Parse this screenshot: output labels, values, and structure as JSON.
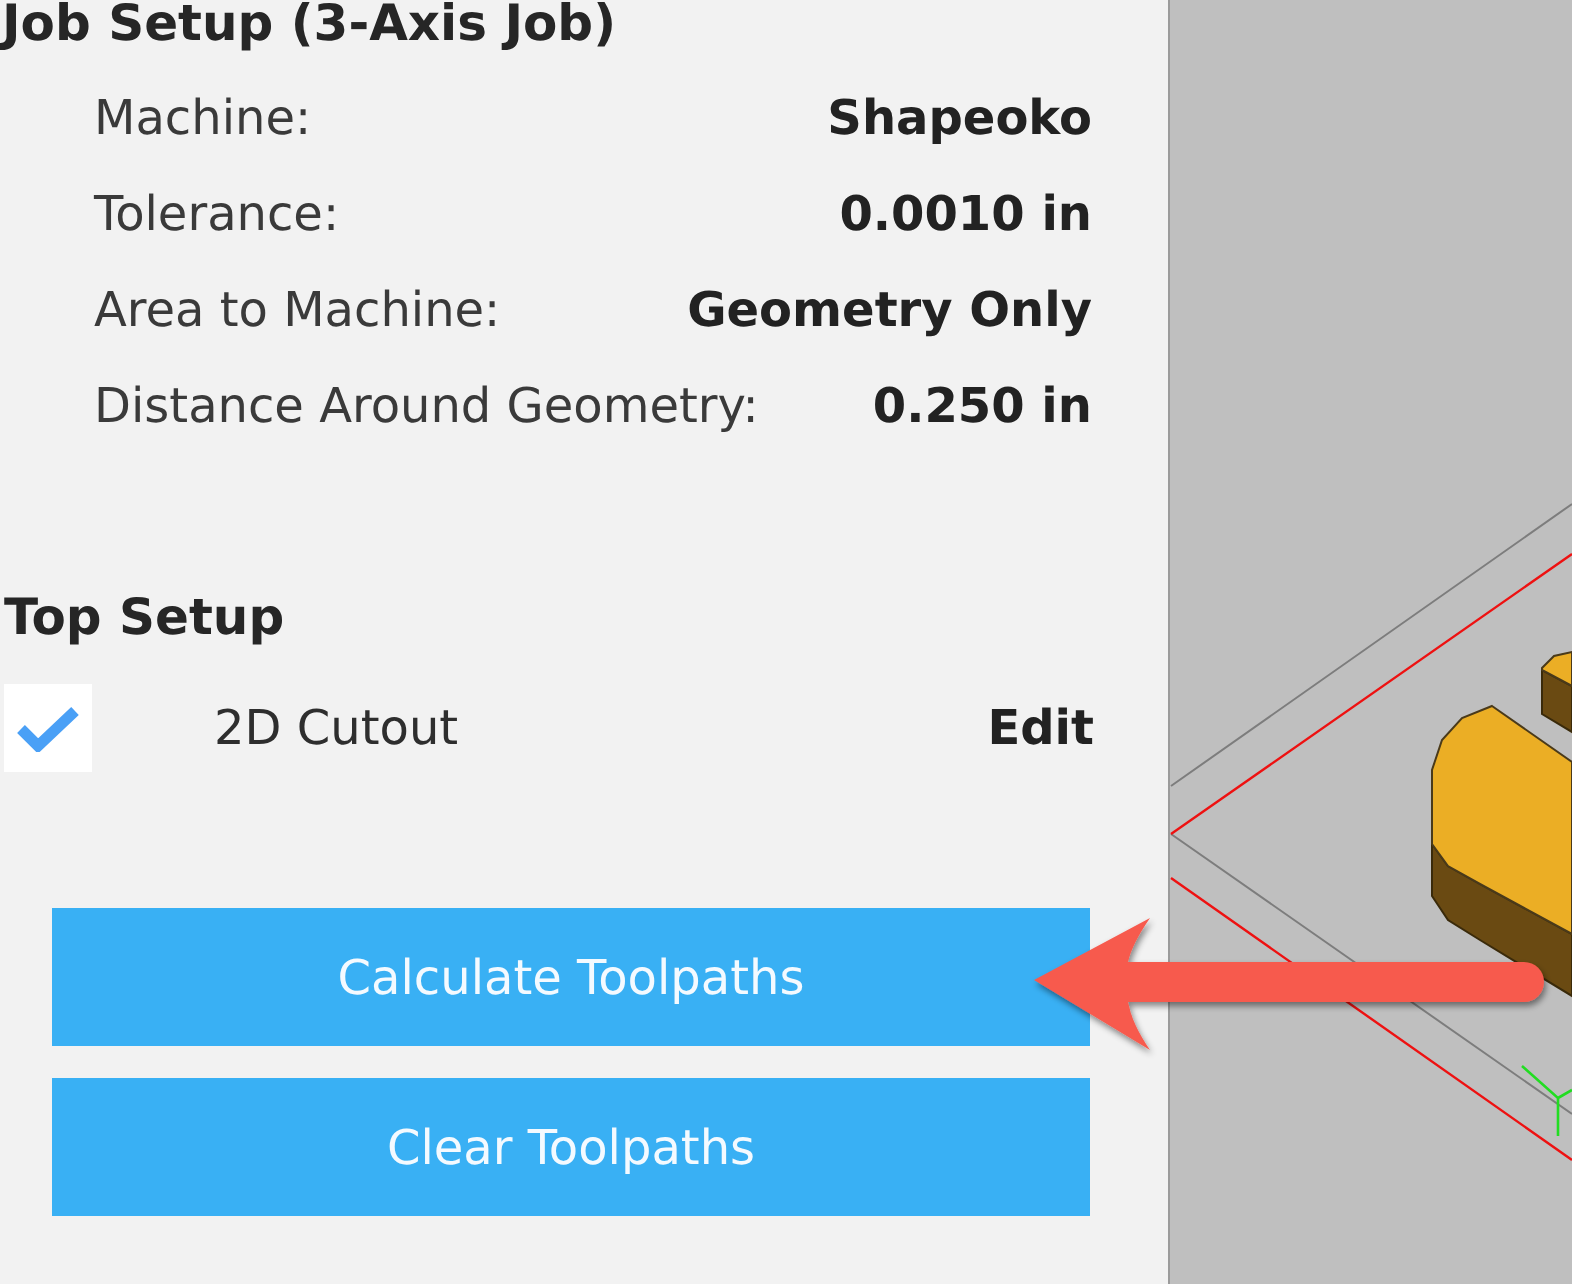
{
  "job_setup": {
    "title": "Job Setup (3-Axis Job)",
    "settings": [
      {
        "label": "Machine:",
        "value": "Shapeoko"
      },
      {
        "label": "Tolerance:",
        "value": "0.0010 in"
      },
      {
        "label": "Area to Machine:",
        "value": "Geometry Only"
      },
      {
        "label": "Distance Around Geometry:",
        "value": "0.250 in"
      }
    ]
  },
  "top_setup": {
    "title": "Top Setup",
    "operations": [
      {
        "name": "2D Cutout",
        "checked": true,
        "action": "Edit"
      }
    ]
  },
  "buttons": [
    "Calculate Toolpaths",
    "Clear Toolpaths"
  ]
}
